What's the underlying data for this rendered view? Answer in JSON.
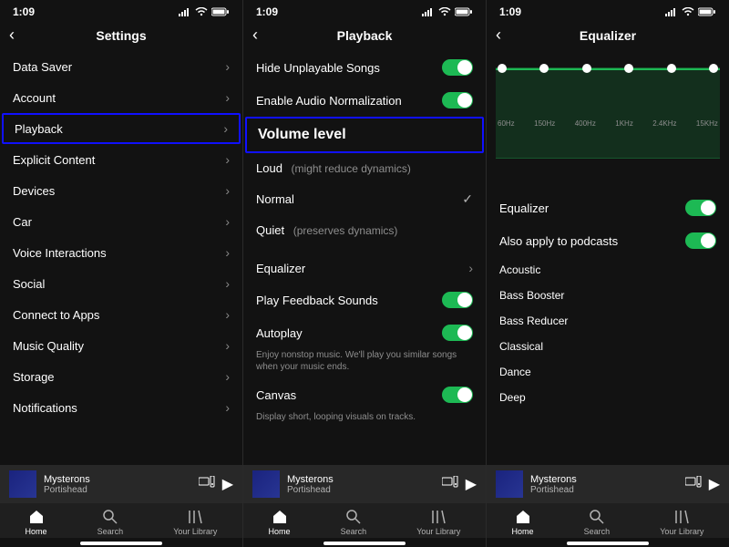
{
  "status": {
    "time": "1:09"
  },
  "nav": {
    "home": "Home",
    "search": "Search",
    "library": "Your Library"
  },
  "nowplaying": {
    "title": "Mysterons",
    "artist": "Portishead"
  },
  "screen1": {
    "title": "Settings",
    "items": [
      "Data Saver",
      "Account",
      "Playback",
      "Explicit Content",
      "Devices",
      "Car",
      "Voice Interactions",
      "Social",
      "Connect to Apps",
      "Music Quality",
      "Storage",
      "Notifications"
    ],
    "highlight_index": 2
  },
  "screen2": {
    "title": "Playback",
    "toggles": {
      "hide": {
        "label": "Hide Unplayable Songs",
        "on": true
      },
      "norm": {
        "label": "Enable Audio Normalization",
        "on": true
      }
    },
    "volume": {
      "header": "Volume level",
      "loud": "Loud",
      "loud_hint": "(might reduce dynamics)",
      "normal": "Normal",
      "quiet": "Quiet",
      "quiet_hint": "(preserves dynamics)"
    },
    "equalizer": "Equalizer",
    "feedback": {
      "label": "Play Feedback Sounds",
      "on": true
    },
    "autoplay": {
      "label": "Autoplay",
      "on": true
    },
    "autoplay_desc": "Enjoy nonstop music. We'll play you similar songs when your music ends.",
    "canvas": {
      "label": "Canvas",
      "on": true
    },
    "canvas_desc": "Display short, looping visuals on tracks."
  },
  "screen3": {
    "title": "Equalizer",
    "freq": [
      "60Hz",
      "150Hz",
      "400Hz",
      "1KHz",
      "2.4KHz",
      "15KHz"
    ],
    "eq_toggle": {
      "label": "Equalizer",
      "on": true
    },
    "podcasts": {
      "label": "Also apply to podcasts",
      "on": true
    },
    "presets": [
      "Acoustic",
      "Bass Booster",
      "Bass Reducer",
      "Classical",
      "Dance",
      "Deep"
    ]
  }
}
